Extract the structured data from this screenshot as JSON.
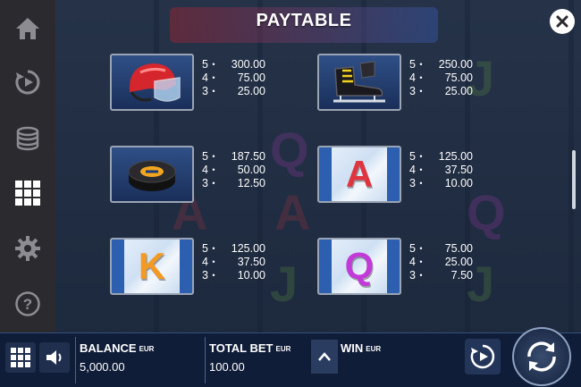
{
  "header": {
    "title": "PAYTABLE"
  },
  "sidebar": {
    "items": [
      {
        "icon": "home-icon"
      },
      {
        "icon": "replay-icon"
      },
      {
        "icon": "coins-icon"
      },
      {
        "icon": "paytable-grid-icon",
        "active": true
      },
      {
        "icon": "gear-icon"
      },
      {
        "icon": "help-icon"
      }
    ]
  },
  "paytable": {
    "symbols": [
      {
        "symbol": "helmet",
        "pays": [
          {
            "count": "5",
            "value": "300.00"
          },
          {
            "count": "4",
            "value": "75.00"
          },
          {
            "count": "3",
            "value": "25.00"
          }
        ]
      },
      {
        "symbol": "skates",
        "pays": [
          {
            "count": "5",
            "value": "250.00"
          },
          {
            "count": "4",
            "value": "75.00"
          },
          {
            "count": "3",
            "value": "25.00"
          }
        ]
      },
      {
        "symbol": "puck",
        "pays": [
          {
            "count": "5",
            "value": "187.50"
          },
          {
            "count": "4",
            "value": "50.00"
          },
          {
            "count": "3",
            "value": "12.50"
          }
        ]
      },
      {
        "symbol": "A",
        "letter_color": "#e0343f",
        "pays": [
          {
            "count": "5",
            "value": "125.00"
          },
          {
            "count": "4",
            "value": "37.50"
          },
          {
            "count": "3",
            "value": "10.00"
          }
        ]
      },
      {
        "symbol": "K",
        "letter_color": "#f49a22",
        "pays": [
          {
            "count": "5",
            "value": "125.00"
          },
          {
            "count": "4",
            "value": "37.50"
          },
          {
            "count": "3",
            "value": "10.00"
          }
        ]
      },
      {
        "symbol": "Q",
        "letter_color": "#c23bd8",
        "pays": [
          {
            "count": "5",
            "value": "75.00"
          },
          {
            "count": "4",
            "value": "25.00"
          },
          {
            "count": "3",
            "value": "7.50"
          }
        ]
      }
    ]
  },
  "bottombar": {
    "balance": {
      "label": "BALANCE",
      "currency": "EUR",
      "value": "5,000.00"
    },
    "total_bet": {
      "label": "TOTAL BET",
      "currency": "EUR",
      "value": "100.00"
    },
    "win": {
      "label": "WIN",
      "currency": "EUR",
      "value": ""
    }
  },
  "colors": {
    "sidebar_bg": "#2b2b2f",
    "bottombar_bg": "#0e1c37",
    "accent_red": "#e0343f"
  }
}
